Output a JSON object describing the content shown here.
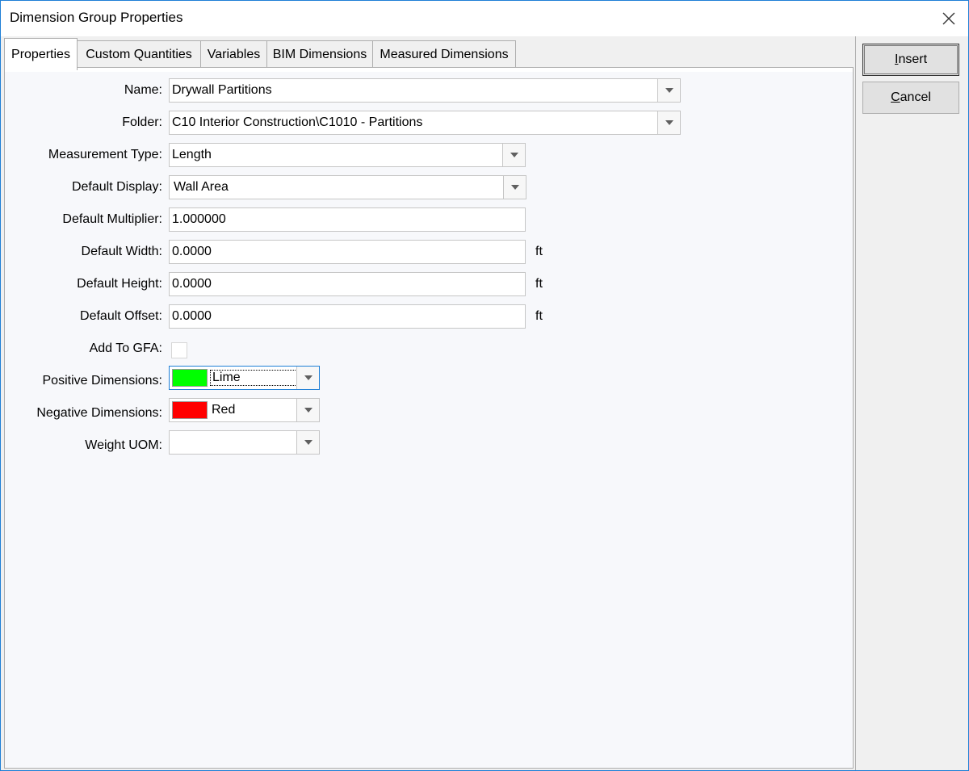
{
  "window": {
    "title": "Dimension Group Properties"
  },
  "tabs": [
    {
      "label": "Properties"
    },
    {
      "label": "Custom Quantities"
    },
    {
      "label": "Variables"
    },
    {
      "label": "BIM Dimensions"
    },
    {
      "label": "Measured Dimensions"
    }
  ],
  "form": {
    "name": {
      "label": "Name:",
      "value": "Drywall Partitions"
    },
    "folder": {
      "label": "Folder:",
      "value": "C10 Interior Construction\\C1010 - Partitions"
    },
    "measurement_type": {
      "label": "Measurement Type:",
      "value": "Length"
    },
    "default_display": {
      "label": "Default Display:",
      "value": "Wall Area"
    },
    "default_multiplier": {
      "label": "Default Multiplier:",
      "value": "1.000000"
    },
    "default_width": {
      "label": "Default Width:",
      "value": "0.0000",
      "unit": "ft"
    },
    "default_height": {
      "label": "Default Height:",
      "value": "0.0000",
      "unit": "ft"
    },
    "default_offset": {
      "label": "Default Offset:",
      "value": "0.0000",
      "unit": "ft"
    },
    "add_to_gfa": {
      "label": "Add To GFA:",
      "checked": false
    },
    "positive_dimensions": {
      "label": "Positive Dimensions:",
      "value": "Lime",
      "color": "#00ff00"
    },
    "negative_dimensions": {
      "label": "Negative Dimensions:",
      "value": "Red",
      "color": "#ff0000"
    },
    "weight_uom": {
      "label": "Weight UOM:",
      "value": ""
    }
  },
  "buttons": {
    "insert_underline": "I",
    "insert_rest": "nsert",
    "cancel_underline": "C",
    "cancel_rest": "ancel"
  },
  "colors": {
    "accent": "#1e7fd6"
  }
}
